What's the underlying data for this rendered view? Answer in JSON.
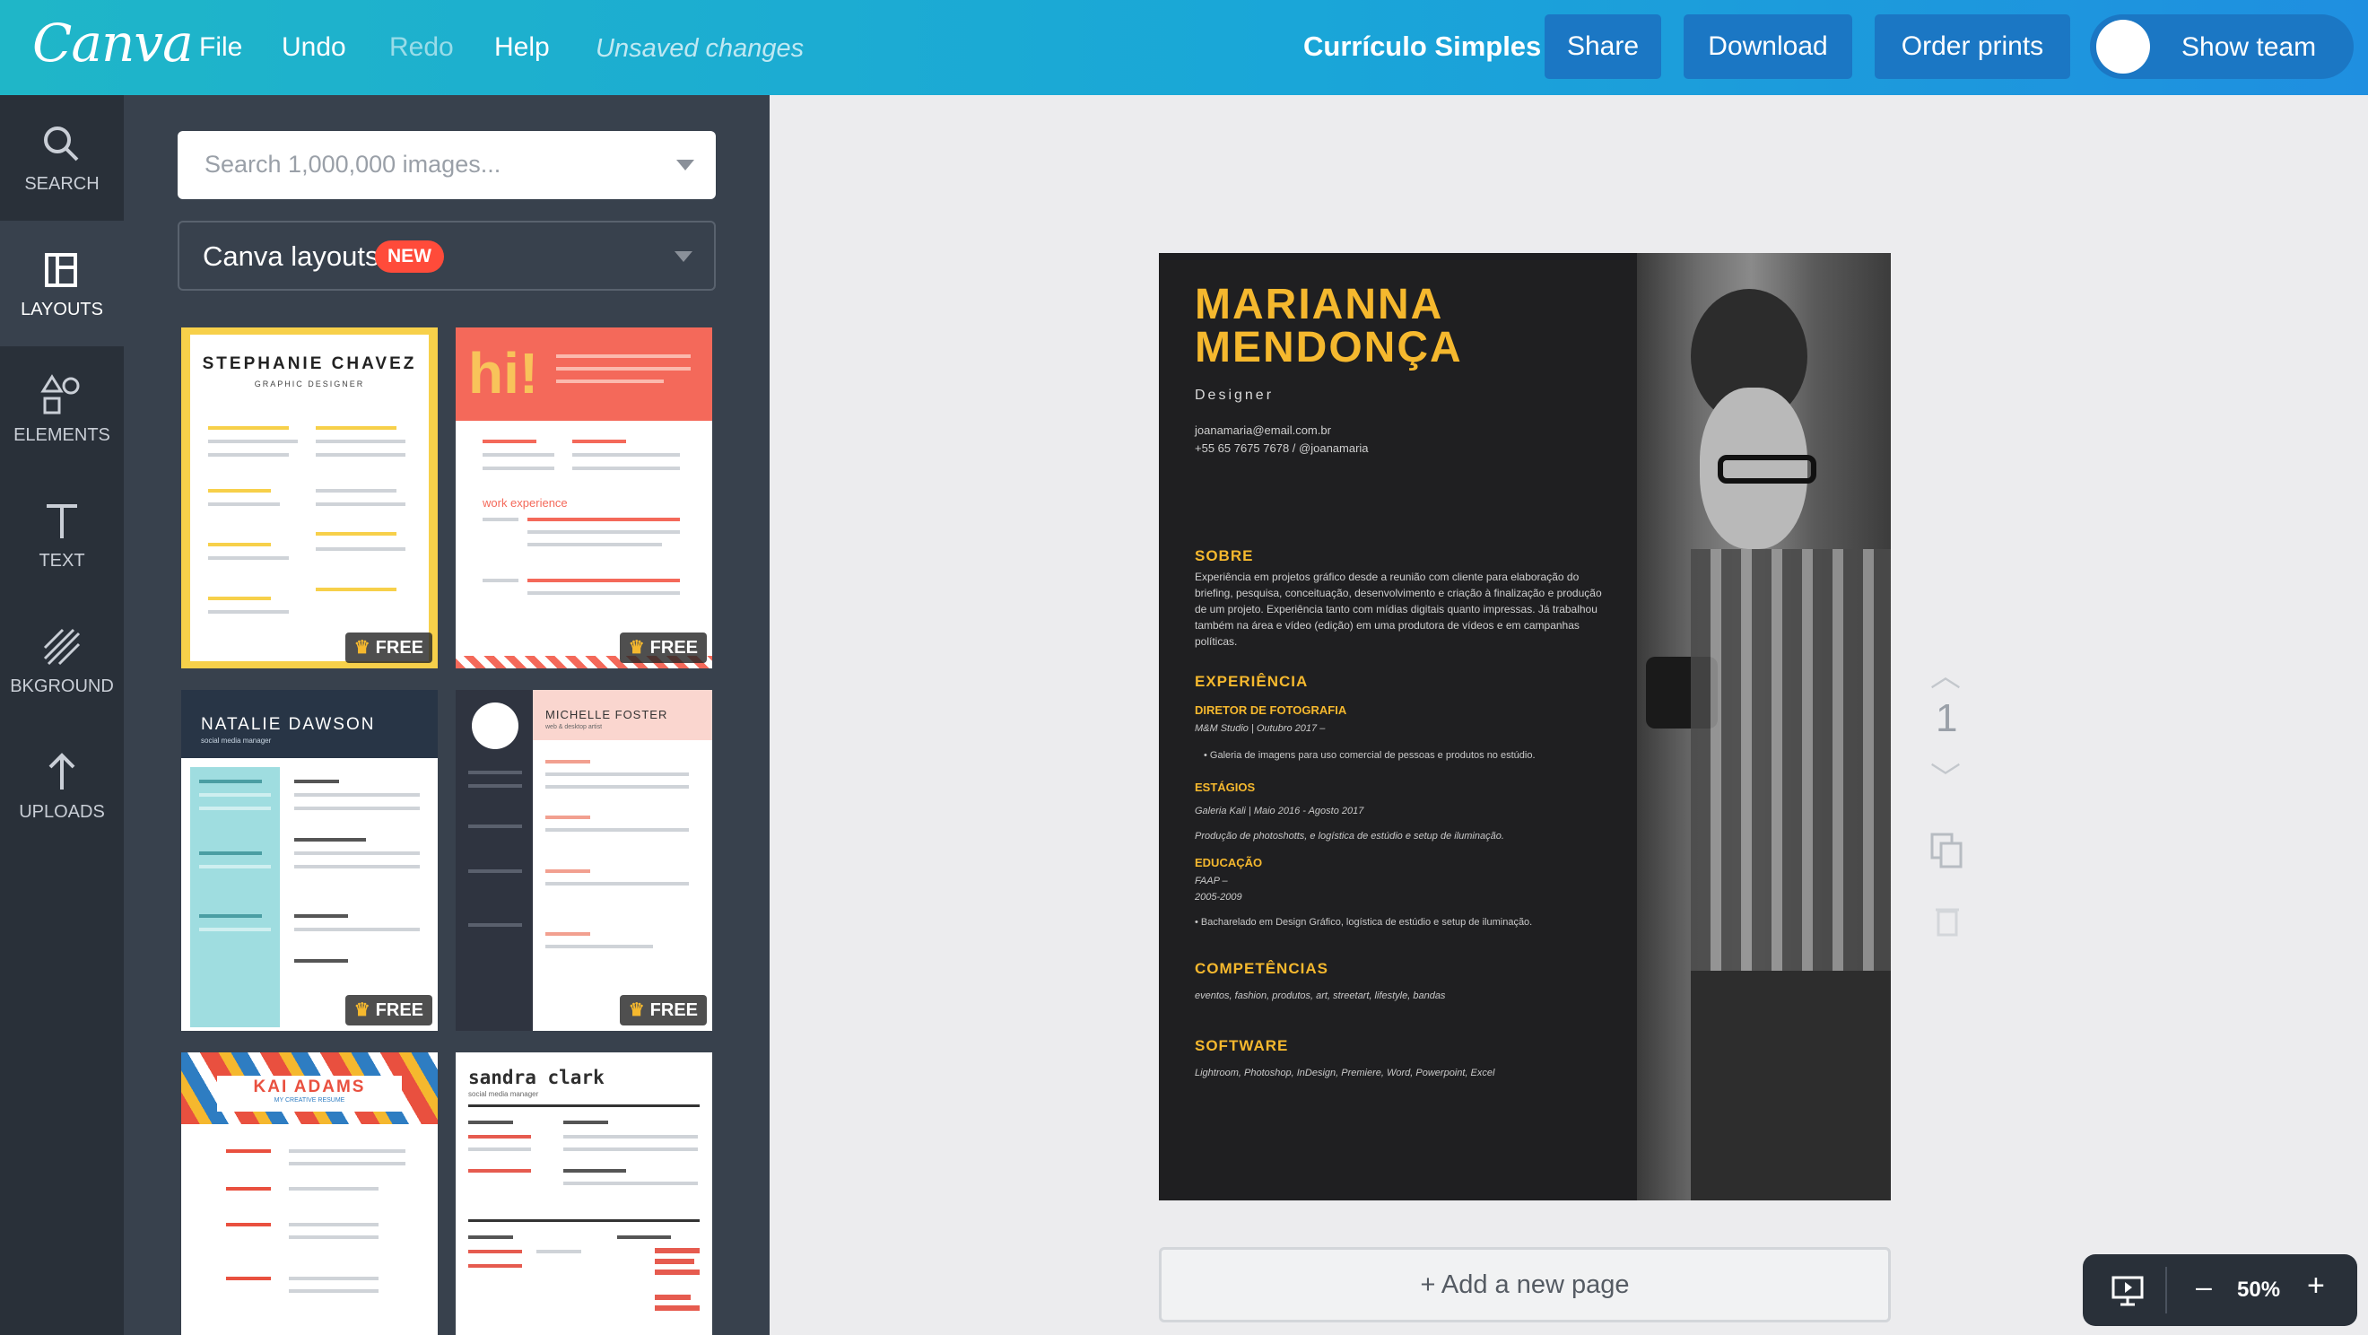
{
  "topbar": {
    "logo": "Canva",
    "menu": {
      "file": "File",
      "undo": "Undo",
      "redo": "Redo",
      "help": "Help"
    },
    "status": "Unsaved changes",
    "doc_title": "Currículo Simples",
    "share": "Share",
    "download": "Download",
    "order_prints": "Order prints",
    "show_team": "Show team"
  },
  "sidenav": {
    "search": "SEARCH",
    "layouts": "LAYOUTS",
    "elements": "ELEMENTS",
    "text": "TEXT",
    "background": "BKGROUND",
    "uploads": "UPLOADS"
  },
  "panel": {
    "search_placeholder": "Search 1,000,000 images...",
    "layout_select": "Canva layouts",
    "new_badge": "NEW",
    "free_label": "FREE",
    "templates": [
      {
        "title": "STEPHANIE CHAVEZ",
        "subtitle": "GRAPHIC DESIGNER"
      },
      {
        "title": "hi!",
        "subtitle": "work experience"
      },
      {
        "title": "NATALIE DAWSON",
        "subtitle": "social media manager"
      },
      {
        "title": "MICHELLE FOSTER",
        "subtitle": "web & desktop artist"
      },
      {
        "title": "KAI ADAMS",
        "subtitle": "MY CREATIVE RESUME"
      },
      {
        "title": "sandra clark",
        "subtitle": "social media manager"
      }
    ]
  },
  "resume": {
    "name_line1": "MARIANNA",
    "name_line2": "MENDONÇA",
    "role": "Designer",
    "email": "joanamaria@email.com.br",
    "phone": "+55 65 7675 7678 / @joanamaria",
    "sobre_title": "SOBRE",
    "sobre_text": "Experiência em projetos gráfico desde a reunião com cliente para elaboração do briefing, pesquisa, conceituação, desenvolvimento e criação à finalização e produção de um projeto. Experiência tanto com mídias digitais quanto impressas. Já trabalhou também na área e vídeo (edição) em uma produtora de vídeos e em campanhas políticas.",
    "exp_title": "EXPERIÊNCIA",
    "exp_job": "DIRETOR DE FOTOGRAFIA",
    "exp_place": "M&M Studio | Outubro 2017 –",
    "exp_bullet": "• Galeria de imagens para uso comercial de pessoas e produtos no estúdio.",
    "estagios_title": "ESTÁGIOS",
    "estagios_place": "Galeria Kali | Maio 2016 - Agosto 2017",
    "estagios_desc": "Produção de photoshotts, e logística de estúdio e setup de iluminação.",
    "edu_title": "EDUCAÇÃO",
    "edu_school": "FAAP –",
    "edu_years": "2005-2009",
    "edu_desc": "• Bacharelado em Design Gráfico, logística de estúdio e setup de iluminação.",
    "comp_title": "COMPETÊNCIAS",
    "comp_text": "eventos, fashion, produtos, art, streetart, lifestyle, bandas",
    "soft_title": "SOFTWARE",
    "soft_text": "Lightroom, Photoshop, InDesign, Premiere, Word, Powerpoint, Excel"
  },
  "canvas": {
    "page_number": "1",
    "add_page": "+ Add a new page",
    "zoom_minus": "–",
    "zoom_level": "50%",
    "zoom_plus": "+"
  },
  "colors": {
    "accent": "#f5b82e",
    "topbar": "#1fb6c8",
    "nav": "#293039",
    "panel": "#38414d"
  }
}
